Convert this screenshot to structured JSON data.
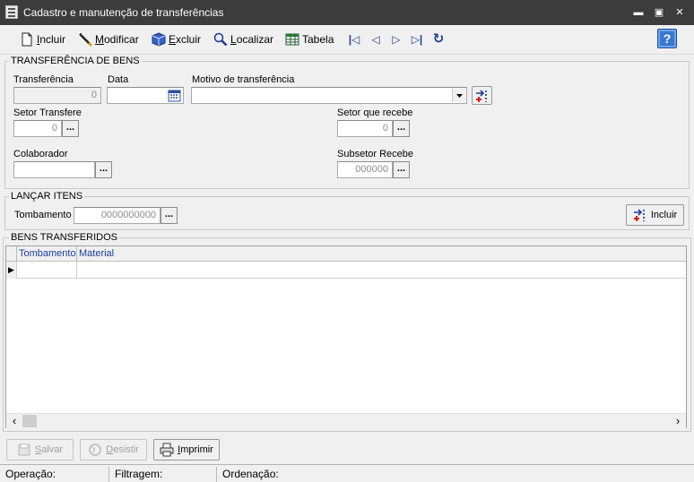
{
  "window": {
    "title": "Cadastro e manutenção de transferências",
    "minimize_glyph": "▬",
    "maximize_glyph": "▣",
    "close_glyph": "✕"
  },
  "toolbar": {
    "incluir": {
      "accel": "I",
      "rest": "ncluir",
      "icon": "new-document-icon"
    },
    "modificar": {
      "accel": "M",
      "rest": "odificar",
      "icon": "pencil-icon"
    },
    "excluir": {
      "accel": "E",
      "rest": "xcluir",
      "icon": "delete-box-icon"
    },
    "localizar": {
      "accel": "L",
      "rest": "ocalizar",
      "icon": "find-icon"
    },
    "tabela": {
      "label": "Tabela",
      "icon": "table-grid-icon"
    },
    "nav": {
      "first": "|◁",
      "prev": "◁",
      "next": "▷",
      "last": "▷|",
      "refresh": "↻"
    },
    "help": "?"
  },
  "transferencia_group": {
    "title": "TRANSFERÊNCIA DE BENS",
    "transferencia_label": "Transferência",
    "transferencia_value": "0",
    "data_label": "Data",
    "data_value": "",
    "motivo_label": "Motivo de transferência",
    "motivo_value": "",
    "setor_transfere_label": "Setor Transfere",
    "setor_transfere_value": "0",
    "setor_recebe_label": "Setor que recebe",
    "setor_recebe_value": "0",
    "colaborador_label": "Colaborador",
    "colaborador_value": "",
    "subsetor_label": "Subsetor Recebe",
    "subsetor_value": "000000",
    "ellipsis": "..."
  },
  "lancar_group": {
    "title": "LANÇAR ITENS",
    "tombamento_label": "Tombamento",
    "tombamento_value": "0000000000",
    "incluir_label": "Incluir",
    "ellipsis": "..."
  },
  "bens_group": {
    "title": "BENS TRANSFERIDOS",
    "columns": [
      "Tombamento",
      "Material"
    ],
    "row_indicator": "▶",
    "scroll_left": "‹",
    "scroll_right": "›"
  },
  "actions": {
    "salvar": {
      "accel": "S",
      "rest": "alvar"
    },
    "desistir": {
      "accel": "D",
      "rest": "esistir"
    },
    "imprimir": {
      "accel": "I",
      "rest": "mprimir"
    }
  },
  "status": {
    "operacao": "Operação:",
    "filtragem": "Filtragem:",
    "ordenacao": "Ordenação:"
  },
  "colors": {
    "titlebar": "#3c3c3c",
    "accent_blue": "#1c3d99",
    "help_blue": "#3a78d4",
    "grid_header_text": "#1a3f9c"
  }
}
